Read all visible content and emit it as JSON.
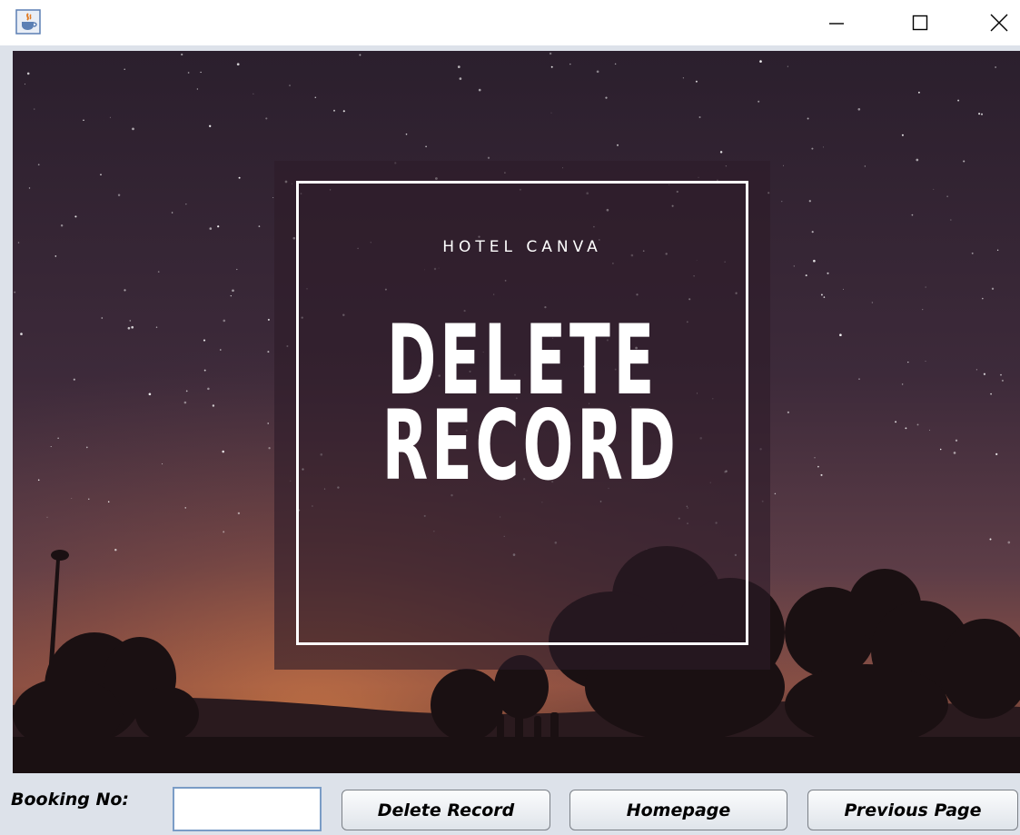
{
  "window": {
    "minimize_symbol": "—",
    "maximize_symbol": "☐",
    "close_symbol": "✕",
    "icon": "java-coffee-cup-icon"
  },
  "banner": {
    "subtitle": "HOTEL CANVA",
    "headline_line1": "DELETE",
    "headline_line2": "RECORD"
  },
  "form": {
    "booking_label": "Booking No:",
    "booking_value": "",
    "delete_button": "Delete Record",
    "homepage_button": "Homepage",
    "previous_button": "Previous Page"
  },
  "colors": {
    "sky_top": "#2e2130",
    "sky_mid": "#4f3646",
    "horizon": "#b2683f",
    "frame_bg": "#dde2ea",
    "input_border": "#7a9cc6"
  }
}
